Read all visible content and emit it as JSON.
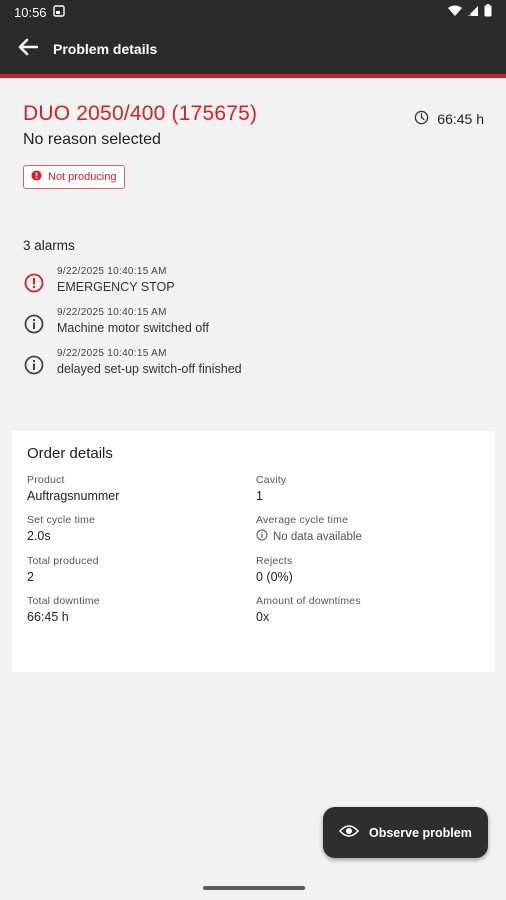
{
  "status_bar": {
    "time": "10:56",
    "icons": [
      "screenshot-icon",
      "wifi-icon",
      "signal-icon",
      "battery-icon"
    ]
  },
  "app_bar": {
    "title": "Problem details",
    "back_icon": "arrow-back-icon",
    "accent_color": "#d0202a",
    "background_color": "#2b2b2b"
  },
  "problem": {
    "machine_title": "DUO 2050/400 (175675)",
    "reason": "No reason selected",
    "duration": "66:45 h",
    "duration_icon": "clock-icon",
    "status_chip": "Not producing",
    "status_chip_icon": "error-icon",
    "title_color": "#d61f26"
  },
  "alarms": {
    "title": "3 alarms",
    "items": [
      {
        "time": "9/22/2025 10:40:15 AM",
        "message": "EMERGENCY STOP",
        "icon": "error-outline-icon",
        "severity_color": "#d61f26"
      },
      {
        "time": "9/22/2025 10:40:15 AM",
        "message": "Machine motor switched off",
        "icon": "info-outline-icon",
        "severity_color": "#444444"
      },
      {
        "time": "9/22/2025 10:40:15 AM",
        "message": "delayed set-up switch-off finished",
        "icon": "info-outline-icon",
        "severity_color": "#444444"
      }
    ]
  },
  "order_details": {
    "title": "Order details",
    "fields": [
      {
        "label": "Product",
        "value": "Auftragsnummer"
      },
      {
        "label": "Cavity",
        "value": "1"
      },
      {
        "label": "Set cycle time",
        "value": "2.0s"
      },
      {
        "label": "Average cycle time",
        "value": "No data available",
        "icon": "info-outline-icon"
      },
      {
        "label": "Total produced",
        "value": "2"
      },
      {
        "label": "Rejects",
        "value": "0 (0%)"
      },
      {
        "label": "Total downtime",
        "value": "66:45 h"
      },
      {
        "label": "Amount of downtimes",
        "value": "0x"
      }
    ]
  },
  "fab": {
    "label": "Observe problem",
    "icon": "eye-icon"
  }
}
